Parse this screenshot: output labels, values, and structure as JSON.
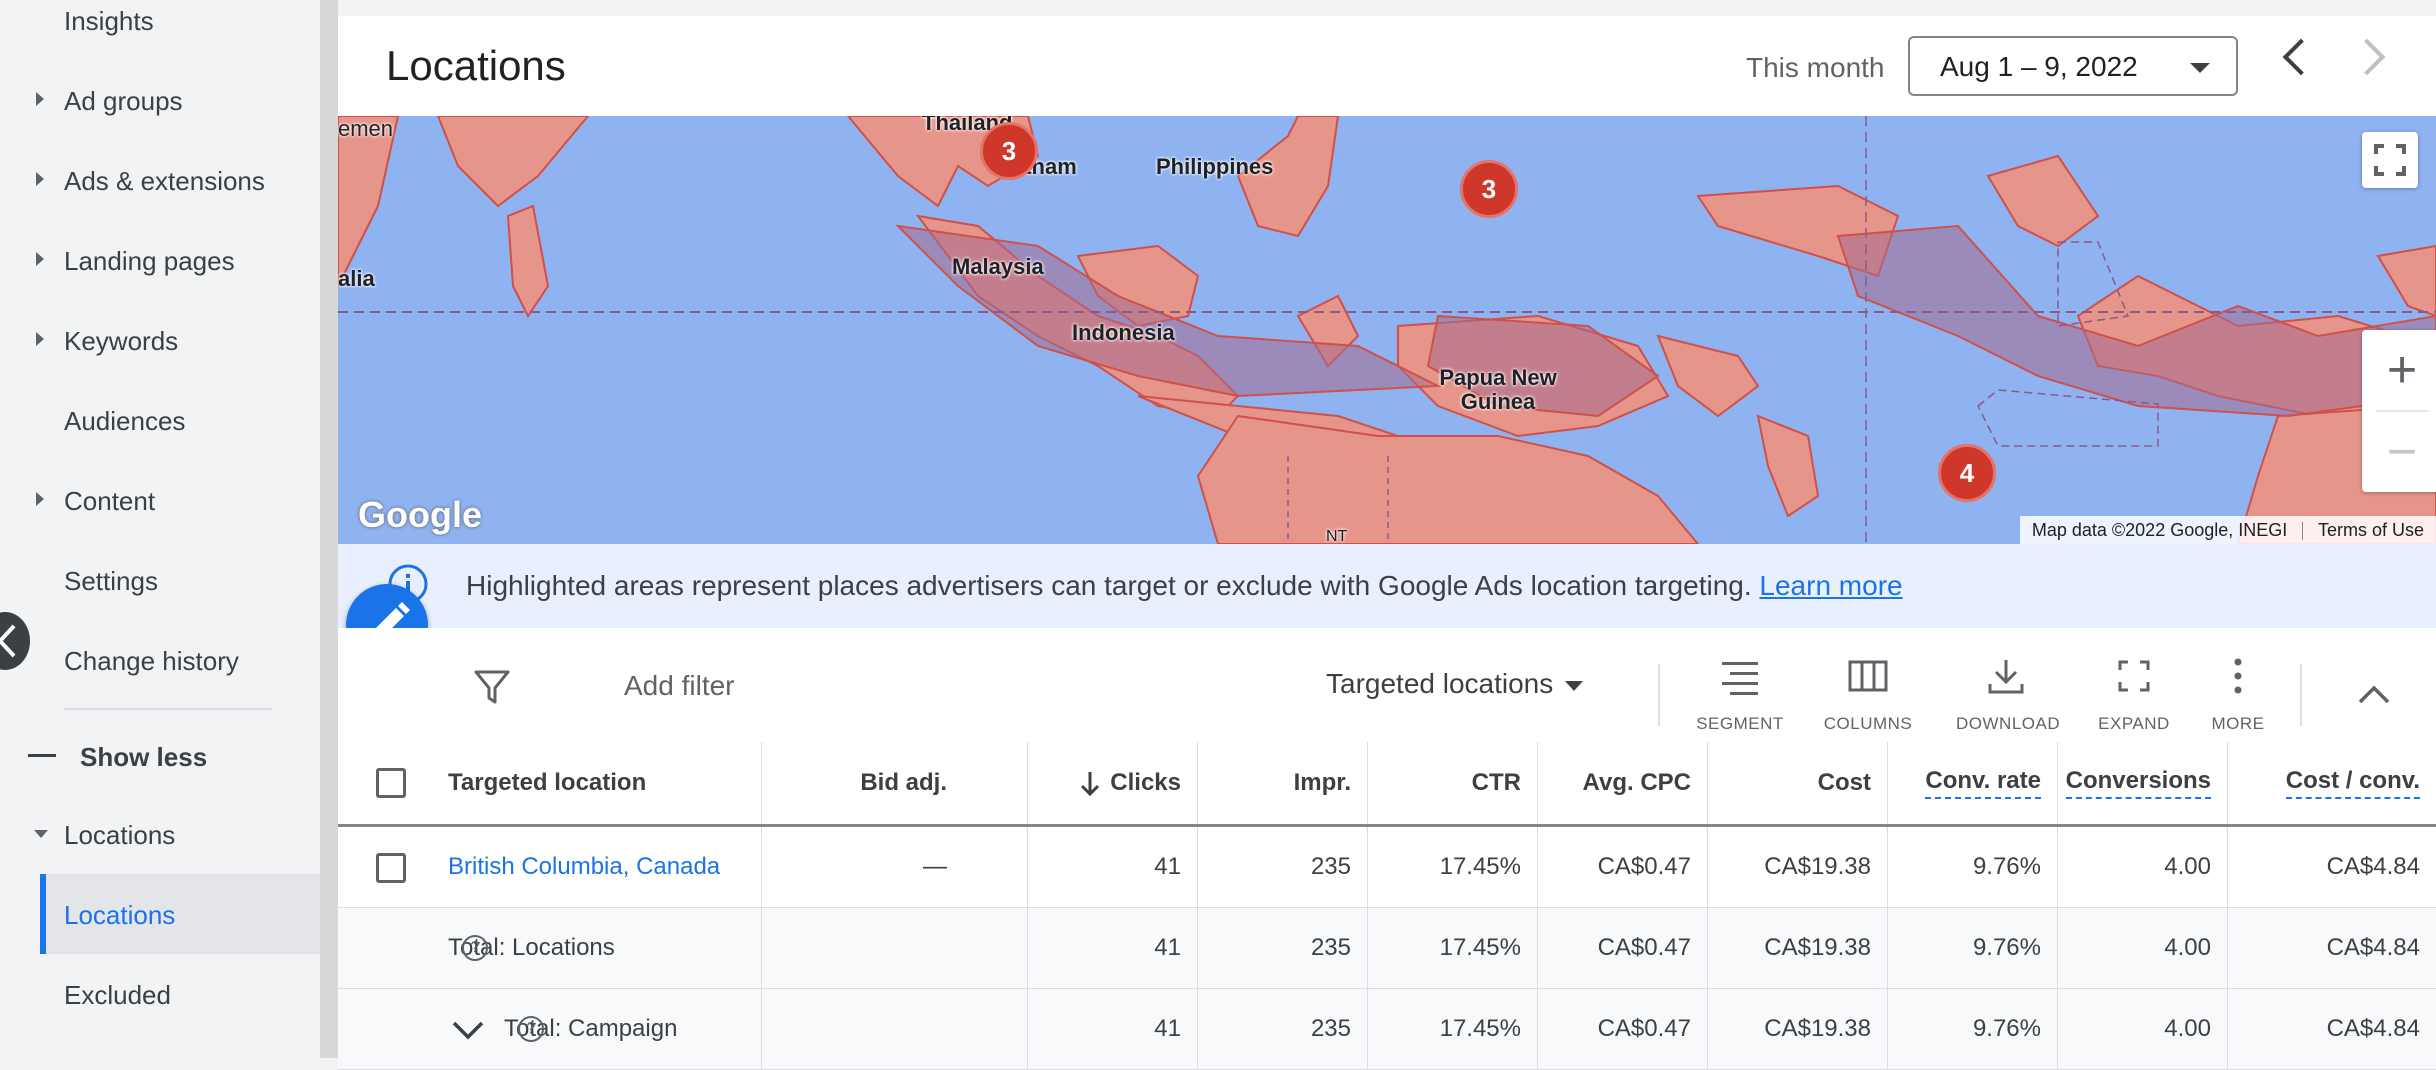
{
  "sidebar": {
    "items": [
      {
        "label": "Insights"
      },
      {
        "label": "Ad groups"
      },
      {
        "label": "Ads & extensions"
      },
      {
        "label": "Landing pages"
      },
      {
        "label": "Keywords"
      },
      {
        "label": "Audiences"
      },
      {
        "label": "Content"
      },
      {
        "label": "Settings"
      },
      {
        "label": "Change history"
      }
    ],
    "show_less": "Show less",
    "locations_group": "Locations",
    "sub_items": [
      {
        "label": "Locations"
      },
      {
        "label": "Excluded"
      }
    ]
  },
  "header": {
    "title": "Locations",
    "period_label": "This month",
    "date_range": "Aug 1 – 9, 2022"
  },
  "map": {
    "labels": {
      "yemen": "emen",
      "thailand": "Thailand",
      "vietnam": "etnam",
      "philippines": "Philippines",
      "malaysia": "Malaysia",
      "somalia": "alia",
      "indonesia": "Indonesia",
      "png": "Papua New Guinea",
      "nt": "NT"
    },
    "clusters": [
      "3",
      "3",
      "4"
    ],
    "logo": "Google",
    "attribution": "Map data ©2022 Google, INEGI",
    "terms": "Terms of Use",
    "zoom_in": "+",
    "zoom_out": "−"
  },
  "banner": {
    "text": "Highlighted areas represent places advertisers can target or exclude with Google Ads location targeting.",
    "link": "Learn more"
  },
  "toolbar": {
    "add_filter": "Add filter",
    "view_selector": "Targeted locations",
    "tools": [
      {
        "label": "SEGMENT",
        "icon": "segment-icon"
      },
      {
        "label": "COLUMNS",
        "icon": "columns-icon"
      },
      {
        "label": "DOWNLOAD",
        "icon": "download-icon"
      },
      {
        "label": "EXPAND",
        "icon": "expand-icon"
      },
      {
        "label": "MORE",
        "icon": "more-vert-icon"
      }
    ]
  },
  "table": {
    "headers": [
      "Targeted location",
      "Bid adj.",
      "Clicks",
      "Impr.",
      "CTR",
      "Avg. CPC",
      "Cost",
      "Conv. rate",
      "Conversions",
      "Cost / conv."
    ],
    "rows": [
      {
        "location": "British Columbia, Canada",
        "bid_adj": "—",
        "clicks": "41",
        "impr": "235",
        "ctr": "17.45%",
        "avg_cpc": "CA$0.47",
        "cost": "CA$19.38",
        "conv_rate": "9.76%",
        "conversions": "4.00",
        "cost_conv": "CA$4.84"
      },
      {
        "location": "Total: Locations",
        "bid_adj": "",
        "clicks": "41",
        "impr": "235",
        "ctr": "17.45%",
        "avg_cpc": "CA$0.47",
        "cost": "CA$19.38",
        "conv_rate": "9.76%",
        "conversions": "4.00",
        "cost_conv": "CA$4.84"
      },
      {
        "location": "Total: Campaign",
        "bid_adj": "",
        "clicks": "41",
        "impr": "235",
        "ctr": "17.45%",
        "avg_cpc": "CA$0.47",
        "cost": "CA$19.38",
        "conv_rate": "9.76%",
        "conversions": "4.00",
        "cost_conv": "CA$4.84"
      }
    ]
  }
}
